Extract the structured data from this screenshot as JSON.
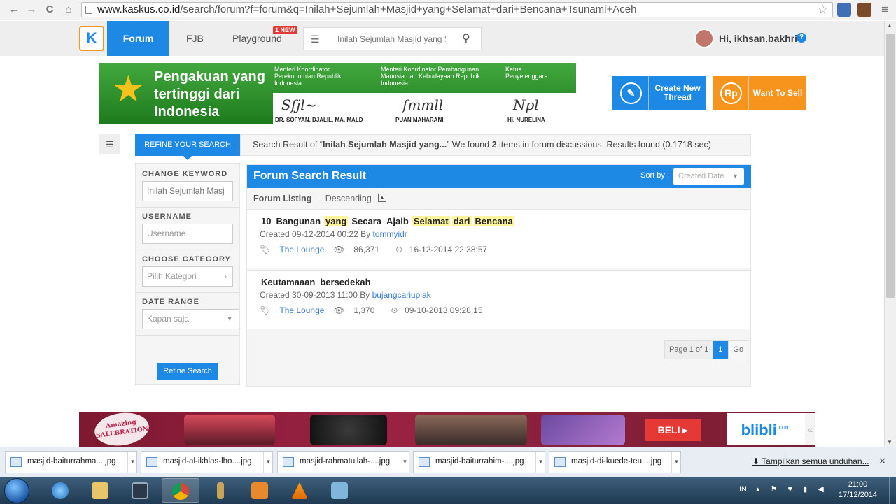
{
  "browser": {
    "url_host": "www.kaskus.co.id",
    "url_path": "/search/forum?f=forum&q=Inilah+Sejumlah+Masjid+yang+Selamat+dari+Bencana+Tsunami+Aceh",
    "back_icon": "←",
    "forward_icon": "→",
    "reload_icon": "C",
    "home_icon": "⌂",
    "star_icon": "☆",
    "menu_icon": "≡"
  },
  "header": {
    "logo_text": "K",
    "nav": [
      {
        "label": "Forum"
      },
      {
        "label": "FJB"
      },
      {
        "label": "Playground"
      }
    ],
    "new_badge": "1 NEW",
    "search_query": "Inilah Sejumlah Masjid yang S",
    "list_icon": "☰",
    "search_icon": "🔍",
    "greeting": "Hi, ikhsan.bakhri",
    "help_icon": "?"
  },
  "banner": {
    "headline": "Pengakuan yang tertinggi dari Indonesia",
    "col1": "Menteri Koordinator Perekonomian Republik Indonesia",
    "col2": "Menteri Koordinator Pembangunan Manusia dan Kebudayaan Republik Indonesia",
    "col3": "Ketua Penyelenggara",
    "name1": "DR. SOFYAN. DJALIL, MA, MALD",
    "name2": "PUAN MAHARANI",
    "name3": "Hj. NURELINA"
  },
  "actions": {
    "create_label": "Create New Thread",
    "create_icon": "✎",
    "sell_label": "Want To Sell",
    "sell_icon": "Rp"
  },
  "search_summary": {
    "tab_label": "REFINE YOUR SEARCH",
    "prefix": "Search Result of “",
    "query": "Inilah Sejumlah Masjid yang...",
    "middle": "” We found ",
    "count": "2",
    "suffix": " items in forum discussions. Results found (0.1718 sec)"
  },
  "filters": {
    "keyword_label": "CHANGE KEYWORD",
    "keyword_value": "Inilah Sejumlah Masj",
    "username_label": "USERNAME",
    "username_placeholder": "Username",
    "category_label": "CHOOSE CATEGORY",
    "category_placeholder": "Pilih Kategori",
    "date_label": "DATE RANGE",
    "date_value": "Kapan saja",
    "refine_button": "Refine Search"
  },
  "results": {
    "title": "Forum Search Result",
    "sort_label": "Sort by :",
    "sort_value": "Created Date",
    "listing_label": "Forum Listing",
    "listing_order": " — Descending",
    "collapse_icon": "^",
    "threads": [
      {
        "title_words": [
          {
            "text": "10",
            "hl": false
          },
          {
            "text": "Bangunan",
            "hl": false
          },
          {
            "text": "yang",
            "hl": true
          },
          {
            "text": "Secara",
            "hl": false
          },
          {
            "text": "Ajaib",
            "hl": false
          },
          {
            "text": "Selamat",
            "hl": true
          },
          {
            "text": "dari",
            "hl": true
          },
          {
            "text": "Bencana",
            "hl": true
          }
        ],
        "created": "Created 09-12-2014 00:22 By ",
        "author": "tommyidr",
        "category": "The Lounge",
        "views": "86,371",
        "last_post": "16-12-2014 22:38:57"
      },
      {
        "title_words": [
          {
            "text": "Keutamaaan",
            "hl": false
          },
          {
            "text": "bersedekah",
            "hl": false
          }
        ],
        "created": "Created 30-09-2013 11:00 By ",
        "author": "bujangcariupiak",
        "category": "The Lounge",
        "views": "1,370",
        "last_post": "09-10-2013 09:28:15"
      }
    ],
    "pager": {
      "label": "Page 1 of 1",
      "current": "1",
      "go": "Go"
    }
  },
  "ad": {
    "sale_text": "Amazing SALEBRATION",
    "beli_label": "BELI ▸",
    "brand": "blibli",
    "brand_suffix": ".com",
    "collapse": "«"
  },
  "downloads": {
    "items": [
      "masjid-baiturrahma....jpg",
      "masjid-al-ikhlas-lho....jpg",
      "masjid-rahmatullah-....jpg",
      "masjid-baiturrahim-....jpg",
      "masjid-di-kuede-teu....jpg"
    ],
    "show_all": "Tampilkan semua unduhan...",
    "close": "✕"
  },
  "taskbar": {
    "lang": "IN",
    "time": "21:00",
    "date": "17/12/2014"
  },
  "colors": {
    "brand_blue": "#1e88e5",
    "brand_orange": "#f7941d",
    "highlight": "#fff59d"
  }
}
